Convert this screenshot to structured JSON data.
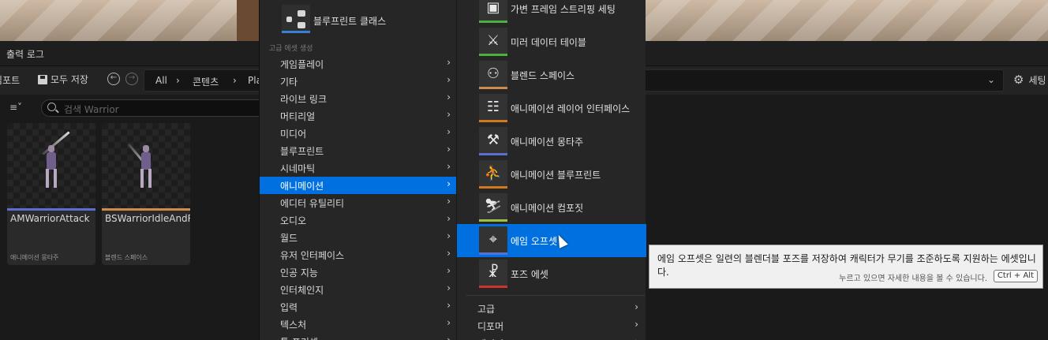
{
  "output_log": {
    "title": "출력 로그"
  },
  "toolbar": {
    "import_label": "임포트",
    "save_all_label": "모두 저장",
    "breadcrumbs": [
      "All",
      "콘텐츠",
      "Pla"
    ],
    "settings_label": "세팅"
  },
  "search": {
    "placeholder": "검색 Warrior"
  },
  "assets": [
    {
      "name": "AMWarriorAttack",
      "type": "애니메이션 몽타주",
      "color": "#5b6fd0"
    },
    {
      "name": "BSWarriorIdleAndRun",
      "type": "블렌드 스페이스",
      "color": "#d08a4a"
    }
  ],
  "context_menu": {
    "blueprint_class_label": "블루프린트 클래스",
    "section_label": "고급 에셋 생성",
    "items": [
      {
        "label": "게임플레이"
      },
      {
        "label": "기타"
      },
      {
        "label": "라이브 링크"
      },
      {
        "label": "머티리얼"
      },
      {
        "label": "미디어"
      },
      {
        "label": "블루프린트"
      },
      {
        "label": "시네마틱"
      },
      {
        "label": "애니메이션",
        "selected": true
      },
      {
        "label": "에디터 유틸리티"
      },
      {
        "label": "오디오"
      },
      {
        "label": "월드"
      },
      {
        "label": "유저 인터페이스"
      },
      {
        "label": "인공 지능"
      },
      {
        "label": "인터체인지"
      },
      {
        "label": "입력"
      },
      {
        "label": "텍스처"
      },
      {
        "label": "툴 프리셋"
      }
    ]
  },
  "submenu": {
    "items": [
      {
        "label": "가변 프레임 스트리핑 세팅",
        "icon": "cube-icon",
        "color": "#4ab040"
      },
      {
        "label": "미러 데이터 테이블",
        "icon": "mirror-figure-icon",
        "color": "#4ab040"
      },
      {
        "label": "블렌드 스페이스",
        "icon": "blend-figures-icon",
        "color": "#d08a4a"
      },
      {
        "label": "애니메이션 레이어 인터페이스",
        "icon": "nodes-icon",
        "color": "#d07a20"
      },
      {
        "label": "애니메이션 몽타주",
        "icon": "montage-runner-icon",
        "color": "#5b6fd0"
      },
      {
        "label": "애니메이션 블루프린트",
        "icon": "runner-nodes-icon",
        "color": "#d07a20"
      },
      {
        "label": "애니메이션 컴포짓",
        "icon": "runner-stack-icon",
        "color": "#a0c040"
      },
      {
        "label": "에임 오프셋",
        "icon": "crosshair-icon",
        "color": "#5b6fd0",
        "selected": true
      },
      {
        "label": "포즈 에셋",
        "icon": "pose-figure-icon",
        "color": "#d03030"
      }
    ],
    "more": [
      {
        "label": "고급"
      },
      {
        "label": "디포머"
      },
      {
        "label": "레거시"
      }
    ]
  },
  "tooltip": {
    "description": "에임 오프셋은 일련의 블렌더블 포즈를 저장하여 캐릭터가 무기를 조준하도록 지원하는 에셋입니다.",
    "hint": "누르고 있으면 자세한 내용을 볼 수 있습니다.",
    "shortcut": "Ctrl + Alt"
  }
}
